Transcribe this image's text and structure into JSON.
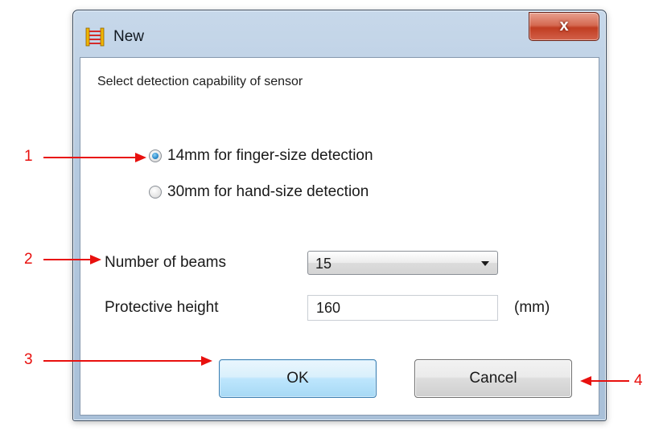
{
  "window": {
    "title": "New",
    "close_label": "x"
  },
  "dialog": {
    "instruction": "Select detection capability of sensor",
    "options": [
      {
        "label": "14mm for finger-size detection",
        "selected": true
      },
      {
        "label": "30mm for hand-size detection",
        "selected": false
      }
    ],
    "beams": {
      "label": "Number of beams",
      "value": "15"
    },
    "height": {
      "label": "Protective height",
      "value": "160",
      "unit": "(mm)"
    },
    "buttons": {
      "ok": "OK",
      "cancel": "Cancel"
    }
  },
  "callouts": [
    "1",
    "2",
    "3",
    "4"
  ],
  "colors": {
    "callout": "#e8100e",
    "radio_selected": "#2a8acb",
    "ok_border": "#3c7fb1"
  }
}
